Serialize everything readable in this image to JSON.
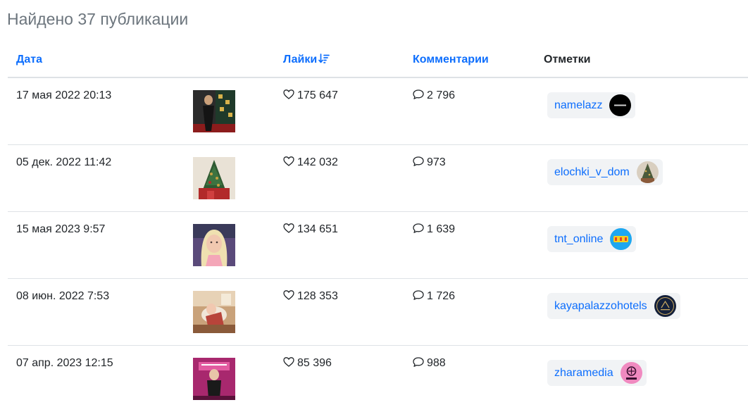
{
  "header": {
    "title": "Найдено 37 публикации"
  },
  "table": {
    "columns": {
      "date": "Дата",
      "likes": "Лайки",
      "comments": "Комментарии",
      "tags": "Отметки"
    },
    "rows": [
      {
        "date": "17 мая 2022 20:13",
        "likes": "175 647",
        "comments": "2 796",
        "tag": "namelazz",
        "thumb_icon": "red-carpet-photo",
        "avatar_icon": "namelazz-logo"
      },
      {
        "date": "05 дек. 2022 11:42",
        "likes": "142 032",
        "comments": "973",
        "tag": "elochki_v_dom",
        "thumb_icon": "christmas-tree-photo",
        "avatar_icon": "christmas-tree-logo"
      },
      {
        "date": "15 мая 2023 9:57",
        "likes": "134 651",
        "comments": "1 639",
        "tag": "tnt_online",
        "thumb_icon": "blonde-woman-photo",
        "avatar_icon": "tnt-logo"
      },
      {
        "date": "08 июн. 2022 7:53",
        "likes": "128 353",
        "comments": "1 726",
        "tag": "kayapalazzohotels",
        "thumb_icon": "hotel-room-photo",
        "avatar_icon": "kaya-palazzo-logo"
      },
      {
        "date": "07 апр. 2023 12:15",
        "likes": "85 396",
        "comments": "988",
        "tag": "zharamedia",
        "thumb_icon": "music-awards-photo",
        "avatar_icon": "zhara-media-logo"
      }
    ]
  },
  "colors": {
    "link": "#0d6efd",
    "muted": "#6c757d",
    "tag_background": "#f1f3f5",
    "border": "#dee2e6"
  }
}
